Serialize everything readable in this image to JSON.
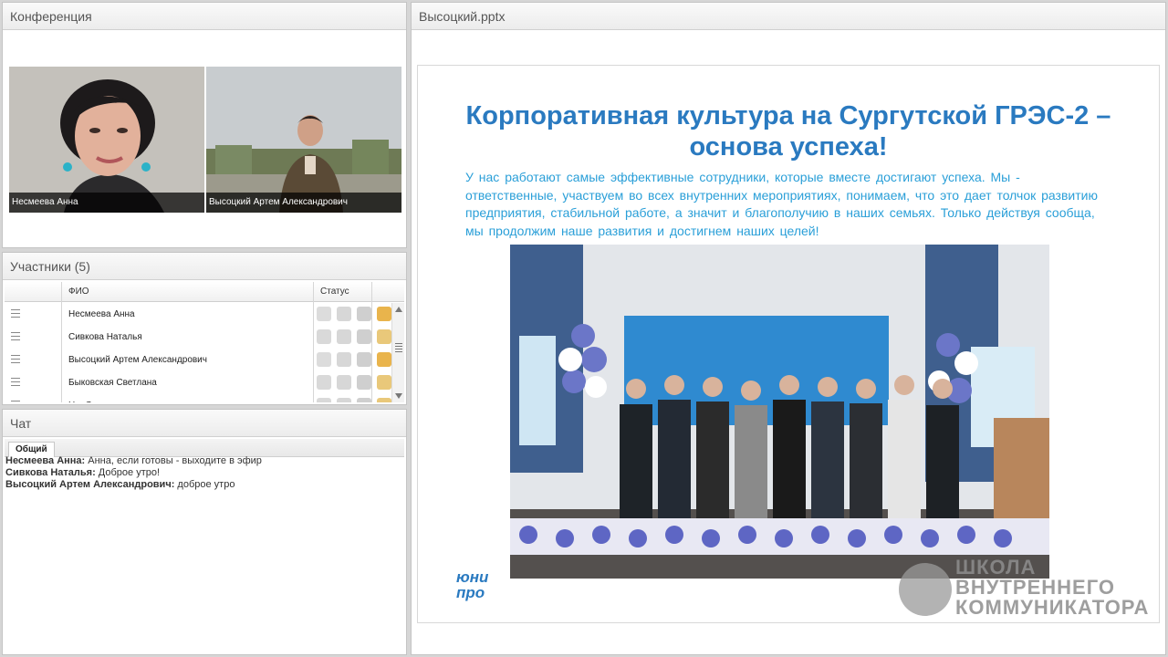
{
  "conference": {
    "title": "Конференция",
    "participants": [
      {
        "name": "Несмеева Анна"
      },
      {
        "name": "Высоцкий Артем Александрович"
      }
    ]
  },
  "participants_panel": {
    "title": "Участники (5)",
    "columns": {
      "name": "ФИО",
      "status": "Статус"
    },
    "rows": [
      {
        "name": "Несмеева Анна"
      },
      {
        "name": "Сивкова  Наталья"
      },
      {
        "name": "Высоцкий Артем Александрович"
      },
      {
        "name": "Быковская Светлана"
      },
      {
        "name": "Н... С..."
      }
    ]
  },
  "chat": {
    "title": "Чат",
    "tab": "Общий",
    "messages": [
      {
        "author": "Несмеева Анна:",
        "text": " Анна, если готовы - выходите в эфир"
      },
      {
        "author": "Сивкова  Наталья:",
        "text": " Доброе утро!"
      },
      {
        "author": "Высоцкий Артем Александрович:",
        "text": " доброе утро"
      }
    ]
  },
  "presentation": {
    "file_name": "Высоцкий.pptx",
    "slide": {
      "title": "Корпоративная культура на Сургутской ГРЭС-2 – основа успеха!",
      "body": "У нас работают самые эффективные сотрудники, которые вместе достигают успеха. Мы - ответственные, участвуем во всех внутренних мероприятиях, понимаем, что это дает толчок развитию предприятия, стабильной работе, а значит и благополучию в наших семьях. Только действуя сообща, мы продолжим наше развития и достигнем наших целей!",
      "logo_line1": "юни",
      "logo_line2": "про"
    },
    "watermark": {
      "line1": "ШКОЛА",
      "line2": "ВНУТРЕННЕГО",
      "line3": "КОММУНИКАТОРА"
    }
  },
  "colors": {
    "slide_title": "#2a7ac0",
    "slide_text": "#2a9fd8"
  }
}
